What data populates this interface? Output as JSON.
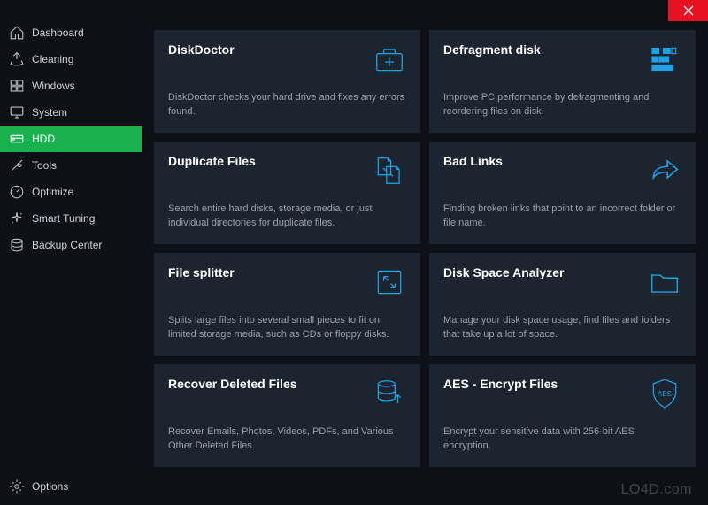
{
  "titlebar": {
    "close_aria": "Close"
  },
  "sidebar": {
    "items": [
      {
        "label": "Dashboard",
        "icon": "home-icon",
        "active": false
      },
      {
        "label": "Cleaning",
        "icon": "recycle-icon",
        "active": false
      },
      {
        "label": "Windows",
        "icon": "windows-icon",
        "active": false
      },
      {
        "label": "System",
        "icon": "monitor-icon",
        "active": false
      },
      {
        "label": "HDD",
        "icon": "hdd-icon",
        "active": true
      },
      {
        "label": "Tools",
        "icon": "tools-icon",
        "active": false
      },
      {
        "label": "Optimize",
        "icon": "gauge-icon",
        "active": false
      },
      {
        "label": "Smart Tuning",
        "icon": "sparkle-icon",
        "active": false
      },
      {
        "label": "Backup Center",
        "icon": "database-icon",
        "active": false
      }
    ],
    "options_label": "Options"
  },
  "cards": [
    {
      "title": "DiskDoctor",
      "desc": "DiskDoctor checks your hard drive and fixes any errors found.",
      "icon": "medkit-icon"
    },
    {
      "title": "Defragment disk",
      "desc": "Improve PC performance by defragmenting and reordering files on disk.",
      "icon": "defrag-icon"
    },
    {
      "title": "Duplicate Files",
      "desc": "Search entire hard disks, storage media, or just individual directories for duplicate files.",
      "icon": "duplicate-icon"
    },
    {
      "title": "Bad Links",
      "desc": "Finding broken links that point to an incorrect folder or file name.",
      "icon": "share-arrow-icon"
    },
    {
      "title": "File splitter",
      "desc": "Splits large files into several small pieces to fit on limited storage media, such as CDs or floppy disks.",
      "icon": "split-icon"
    },
    {
      "title": "Disk Space Analyzer",
      "desc": "Manage your disk space usage, find files and folders that take up a lot of space.",
      "icon": "folder-icon"
    },
    {
      "title": "Recover Deleted Files",
      "desc": "Recover Emails, Photos, Videos, PDFs, and Various Other Deleted Files.",
      "icon": "recover-icon"
    },
    {
      "title": "AES - Encrypt Files",
      "desc": "Encrypt your sensitive data with 256-bit AES encryption.",
      "icon": "shield-aes-icon"
    }
  ],
  "watermark": "LO4D.com"
}
